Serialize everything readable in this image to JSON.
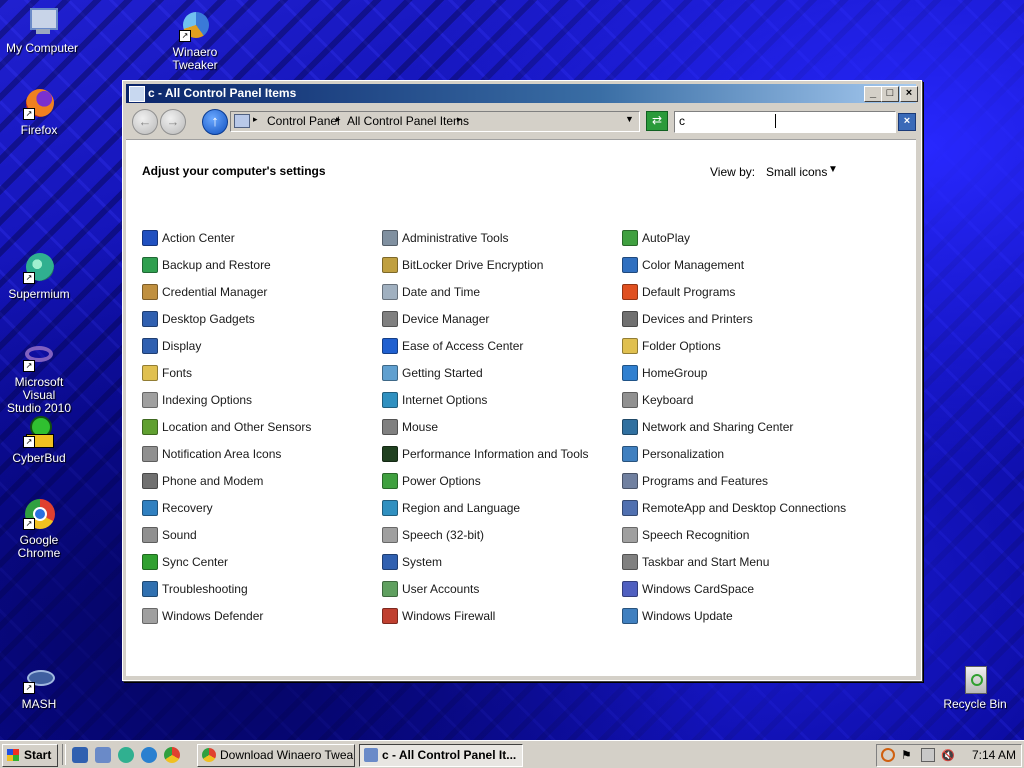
{
  "desktop": {
    "icons": [
      {
        "label": "My Computer",
        "icon": "computer-icon",
        "color": "#6a8ac8"
      },
      {
        "label": "Winaero\nTweaker",
        "icon": "winaero-tweaker-icon",
        "color": "#e0a020"
      },
      {
        "label": "Firefox",
        "icon": "firefox-icon",
        "color": "#e05a10"
      },
      {
        "label": "Supermium",
        "icon": "supermium-icon",
        "color": "#30b090"
      },
      {
        "label": "Microsoft Visual\nStudio 2010",
        "icon": "visual-studio-icon",
        "color": "#7050b0"
      },
      {
        "label": "CyberBud",
        "icon": "cyberbud-icon",
        "color": "#30c030"
      },
      {
        "label": "Google Chrome",
        "icon": "chrome-icon",
        "color": "#e04030"
      },
      {
        "label": "MASH",
        "icon": "mash-icon",
        "color": "#4060a0"
      },
      {
        "label": "Recycle Bin",
        "icon": "recycle-bin-icon",
        "color": "#d8d8d8"
      }
    ]
  },
  "window": {
    "title": "c - All Control Panel Items",
    "breadcrumbs": [
      "Control Panel",
      "All Control Panel Items"
    ],
    "search_value": "c",
    "heading": "Adjust your computer's settings",
    "view_by_label": "View by:",
    "view_by_value": "Small icons"
  },
  "items": [
    {
      "label": "Action Center",
      "color": "#2050c0"
    },
    {
      "label": "Administrative Tools",
      "color": "#8090a0"
    },
    {
      "label": "AutoPlay",
      "color": "#40a040"
    },
    {
      "label": "Backup and Restore",
      "color": "#30a050"
    },
    {
      "label": "BitLocker Drive Encryption",
      "color": "#c0a040"
    },
    {
      "label": "Color Management",
      "color": "#3070c0"
    },
    {
      "label": "Credential Manager",
      "color": "#c09040"
    },
    {
      "label": "Date and Time",
      "color": "#a0b0c0"
    },
    {
      "label": "Default Programs",
      "color": "#e05020"
    },
    {
      "label": "Desktop Gadgets",
      "color": "#3060b0"
    },
    {
      "label": "Device Manager",
      "color": "#808080"
    },
    {
      "label": "Devices and Printers",
      "color": "#707070"
    },
    {
      "label": "Display",
      "color": "#3060b0"
    },
    {
      "label": "Ease of Access Center",
      "color": "#2060d0"
    },
    {
      "label": "Folder Options",
      "color": "#e0c050"
    },
    {
      "label": "Fonts",
      "color": "#e0c050"
    },
    {
      "label": "Getting Started",
      "color": "#60a0d0"
    },
    {
      "label": "HomeGroup",
      "color": "#3080d0"
    },
    {
      "label": "Indexing Options",
      "color": "#a0a0a0"
    },
    {
      "label": "Internet Options",
      "color": "#3090c0"
    },
    {
      "label": "Keyboard",
      "color": "#909090"
    },
    {
      "label": "Location and Other Sensors",
      "color": "#60a030"
    },
    {
      "label": "Mouse",
      "color": "#808080"
    },
    {
      "label": "Network and Sharing Center",
      "color": "#3070a0"
    },
    {
      "label": "Notification Area Icons",
      "color": "#909090"
    },
    {
      "label": "Performance Information and Tools",
      "color": "#204020"
    },
    {
      "label": "Personalization",
      "color": "#4080c0"
    },
    {
      "label": "Phone and Modem",
      "color": "#707070"
    },
    {
      "label": "Power Options",
      "color": "#40a040"
    },
    {
      "label": "Programs and Features",
      "color": "#7080a0"
    },
    {
      "label": "Recovery",
      "color": "#3080c0"
    },
    {
      "label": "Region and Language",
      "color": "#3090c0"
    },
    {
      "label": "RemoteApp and Desktop Connections",
      "color": "#5070b0"
    },
    {
      "label": "Sound",
      "color": "#909090"
    },
    {
      "label": "Speech (32-bit)",
      "color": "#a0a0a0"
    },
    {
      "label": "Speech Recognition",
      "color": "#a0a0a0"
    },
    {
      "label": "Sync Center",
      "color": "#30a030"
    },
    {
      "label": "System",
      "color": "#3060b0"
    },
    {
      "label": "Taskbar and Start Menu",
      "color": "#808080"
    },
    {
      "label": "Troubleshooting",
      "color": "#3070b0"
    },
    {
      "label": "User Accounts",
      "color": "#60a060"
    },
    {
      "label": "Windows CardSpace",
      "color": "#5060c0"
    },
    {
      "label": "Windows Defender",
      "color": "#a0a0a0"
    },
    {
      "label": "Windows Firewall",
      "color": "#c04030"
    },
    {
      "label": "Windows Update",
      "color": "#4080c0"
    }
  ],
  "taskbar": {
    "start_label": "Start",
    "tasks": [
      {
        "label": "Download Winaero Twea...",
        "icon": "chrome-icon",
        "color": "#e04030"
      },
      {
        "label": "c - All Control Panel It...",
        "icon": "control-panel-icon",
        "color": "#6a8ac8"
      }
    ],
    "clock": "7:14 AM"
  }
}
